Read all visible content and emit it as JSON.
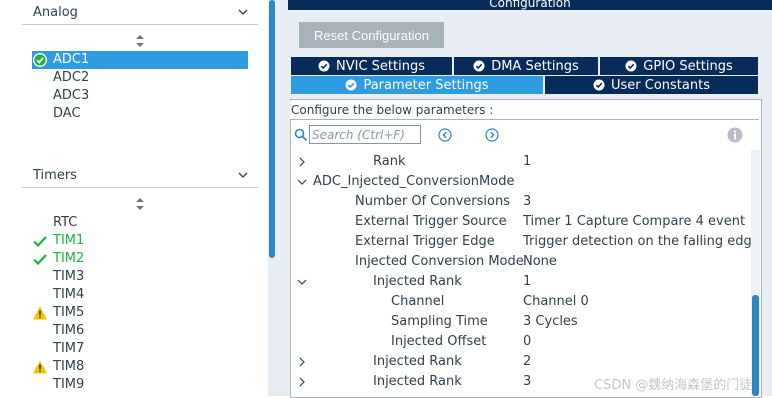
{
  "left": {
    "analog": {
      "header": "Analog",
      "items": [
        {
          "label": "ADC1",
          "status": "ok",
          "selected": true
        },
        {
          "label": "ADC2"
        },
        {
          "label": "ADC3"
        },
        {
          "label": "DAC"
        }
      ]
    },
    "timers": {
      "header": "Timers",
      "items": [
        {
          "label": "RTC"
        },
        {
          "label": "TIM1",
          "status": "ok"
        },
        {
          "label": "TIM2",
          "status": "ok"
        },
        {
          "label": "TIM3"
        },
        {
          "label": "TIM4"
        },
        {
          "label": "TIM5",
          "status": "warning"
        },
        {
          "label": "TIM6"
        },
        {
          "label": "TIM7"
        },
        {
          "label": "TIM8",
          "status": "warning"
        },
        {
          "label": "TIM9"
        }
      ]
    }
  },
  "right": {
    "title": "Configuration",
    "reset_button": "Reset Configuration",
    "tabs": {
      "nvic": "NVIC Settings",
      "dma": "DMA Settings",
      "gpio": "GPIO Settings",
      "parameter": "Parameter Settings",
      "user_constants": "User Constants"
    },
    "panel_header": "Configure the below parameters :",
    "search_placeholder": "Search (Ctrl+F)",
    "rows": [
      {
        "name": "Rank",
        "value": "1",
        "expander": "collapsed"
      },
      {
        "name": "ADC_Injected_ConversionMode",
        "value": "",
        "expander": "expanded"
      },
      {
        "name": "Number Of Conversions",
        "value": "3"
      },
      {
        "name": "External Trigger Source",
        "value": "Timer 1 Capture Compare 4 event"
      },
      {
        "name": "External Trigger Edge",
        "value": "Trigger detection on the falling edge"
      },
      {
        "name": "Injected Conversion Mode",
        "value": "None"
      },
      {
        "name": "Injected Rank",
        "value": "1",
        "expander": "expanded"
      },
      {
        "name": "Channel",
        "value": "Channel 0"
      },
      {
        "name": "Sampling Time",
        "value": "3 Cycles"
      },
      {
        "name": "Injected Offset",
        "value": "0"
      },
      {
        "name": "Injected Rank",
        "value": "2",
        "expander": "collapsed"
      },
      {
        "name": "Injected Rank",
        "value": "3",
        "expander": "collapsed"
      }
    ]
  },
  "watermark": "CSDN @魏纳海森堡的门徒",
  "colors": {
    "accent": "#2f9be0",
    "tab_dark": "#082c5a",
    "ok_green": "#1cb441",
    "warning_yellow": "#f2c500"
  }
}
